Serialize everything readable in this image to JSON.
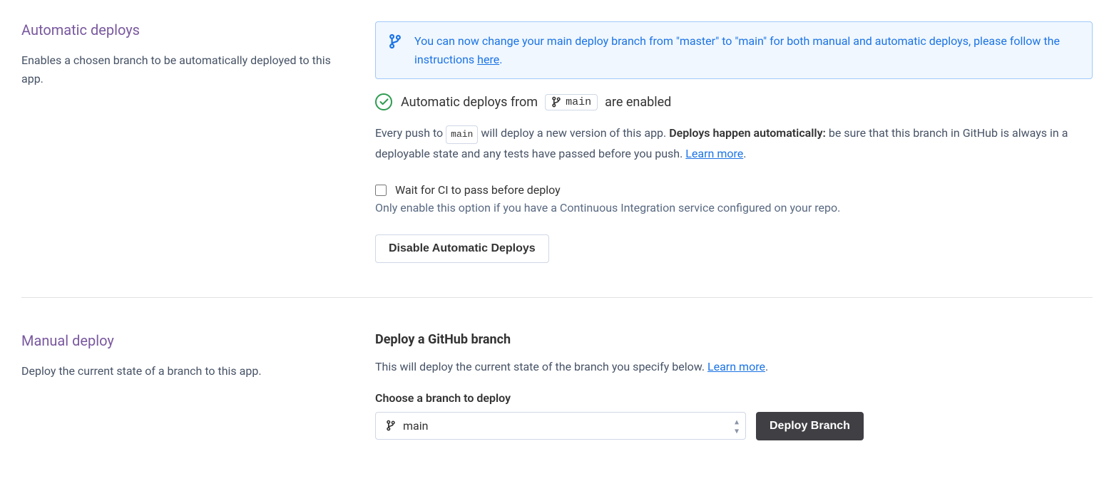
{
  "auto": {
    "title": "Automatic deploys",
    "description": "Enables a chosen branch to be automatically deployed to this app.",
    "banner_text_pre": "You can now change your main deploy branch from \"master\" to \"main\" for both manual and automatic deploys, please follow the instructions ",
    "banner_link": "here",
    "banner_text_post": ".",
    "status_prefix": "Automatic deploys from",
    "status_branch": "main",
    "status_suffix": "are enabled",
    "desc_pre": "Every push to ",
    "desc_branch": "main",
    "desc_mid": " will deploy a new version of this app. ",
    "desc_bold": "Deploys happen automatically:",
    "desc_post": " be sure that this branch in GitHub is always in a deployable state and any tests have passed before you push. ",
    "desc_learn": "Learn more",
    "desc_end": ".",
    "ci_label": "Wait for CI to pass before deploy",
    "ci_helper": "Only enable this option if you have a Continuous Integration service configured on your repo.",
    "disable_button": "Disable Automatic Deploys"
  },
  "manual": {
    "title": "Manual deploy",
    "description": "Deploy the current state of a branch to this app.",
    "heading": "Deploy a GitHub branch",
    "body_pre": "This will deploy the current state of the branch you specify below. ",
    "body_learn": "Learn more",
    "body_end": ".",
    "choose_label": "Choose a branch to deploy",
    "selected_branch": "main",
    "deploy_button": "Deploy Branch"
  }
}
